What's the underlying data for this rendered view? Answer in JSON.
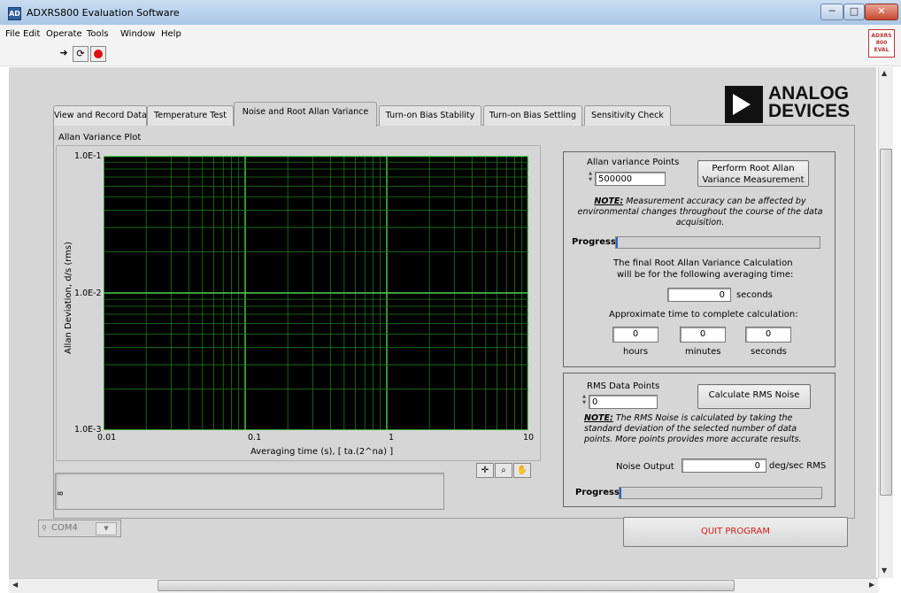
{
  "window": {
    "title": "ADXRS800 Evaluation Software",
    "icon_text": "AD",
    "minimize": "─",
    "maximize": "□",
    "close": "✕"
  },
  "menu": [
    "File",
    "Edit",
    "Operate",
    "Tools",
    "Window",
    "Help"
  ],
  "toolbar": {
    "run_icon": "run-arrow-icon",
    "run_continuous_icon": "run-continuous-icon",
    "abort_icon": "abort-icon"
  },
  "vi_icon": {
    "line1": "ADXRS",
    "line2": "800",
    "line3": "EVAL"
  },
  "logo": {
    "line1": "ANALOG",
    "line2": "DEVICES"
  },
  "tabs": [
    {
      "label": "View and Record Data",
      "active": false
    },
    {
      "label": "Temperature Test",
      "active": false
    },
    {
      "label": "Noise and Root Allan Variance",
      "active": true
    },
    {
      "label": "Turn-on Bias Stability",
      "active": false
    },
    {
      "label": "Turn-on Bias Settling",
      "active": false
    },
    {
      "label": "Sensitivity Check",
      "active": false
    }
  ],
  "graph": {
    "title": "Allan Variance Plot",
    "ylabel": "Allan Deviation, d/s (rms)",
    "xlabel": "Averaging time (s), [ ta.(2^na) ]",
    "y_ticks": [
      "1.0E-1",
      "1.0E-2",
      "1.0E-3"
    ],
    "x_ticks": [
      "0.01",
      "0.1",
      "1",
      "10"
    ]
  },
  "allan": {
    "points_label": "Allan variance Points",
    "points_value": "500000",
    "perform_button": "Perform Root Allan Variance Measurement",
    "note_bold": "NOTE:",
    "note_text": "Measurement accuracy can be affected by environmental changes throughout the course of the data acquisition.",
    "progress_label": "Progress",
    "progress_value": 0.01,
    "final_text_1": "The final Root Allan Variance Calculation",
    "final_text_2": "will be for the following averaging time:",
    "seconds_value": "0",
    "seconds_unit": "seconds",
    "approx_label": "Approximate time to complete calculation:",
    "hours_value": "0",
    "minutes_value": "0",
    "secs_value": "0",
    "hours_label": "hours",
    "minutes_label": "minutes",
    "secs_label": "seconds"
  },
  "rms": {
    "points_label": "RMS Data Points",
    "points_value": "0",
    "calc_button": "Calculate RMS Noise",
    "note_bold": "NOTE:",
    "note_text": "The RMS Noise is calculated by taking the standard deviation of the selected number of data points. More points provides more accurate results.",
    "noise_label": "Noise Output",
    "noise_value": "0",
    "noise_unit": "deg/sec RMS",
    "progress_label": "Progress",
    "progress_value": 0.01
  },
  "com": {
    "value": "COM4"
  },
  "quit_button": "QUIT PROGRAM",
  "msgbox_label": "8"
}
